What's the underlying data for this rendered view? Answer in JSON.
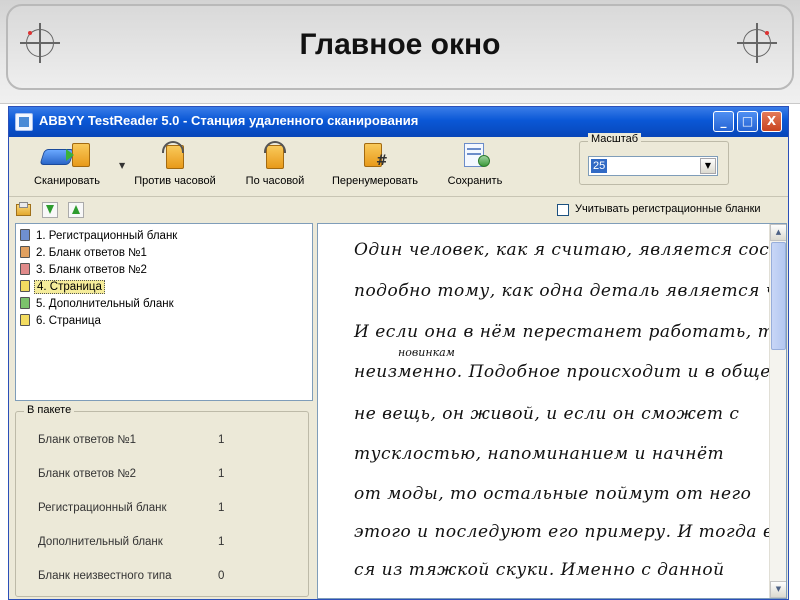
{
  "slide": {
    "title": "Главное окно"
  },
  "window": {
    "title": "ABBYY TestReader 5.0 - Станция удаленного сканирования",
    "controls": {
      "minimize": "_",
      "maximize": "□",
      "close": "X"
    }
  },
  "toolbar": {
    "buttons": [
      {
        "label": "Сканировать",
        "icon": "scanner-icon"
      },
      {
        "label": "Против часовой",
        "icon": "rotate-ccw-icon"
      },
      {
        "label": "По часовой",
        "icon": "rotate-cw-icon"
      },
      {
        "label": "Перенумеровать",
        "icon": "renumber-icon"
      },
      {
        "label": "Сохранить",
        "icon": "save-icon"
      }
    ],
    "scale": {
      "label": "Масштаб",
      "value": "25"
    }
  },
  "toolbar2": {
    "checkbox_label": "Учитывать регистрационные бланки",
    "checkbox_checked": false
  },
  "doc_list": {
    "items": [
      {
        "label": "1. Регистрационный бланк",
        "icon_color": "#6f8fd0"
      },
      {
        "label": "2. Бланк ответов №1",
        "icon_color": "#e0a060"
      },
      {
        "label": "3. Бланк ответов №2",
        "icon_color": "#e08a8a"
      },
      {
        "label": "4. Страница",
        "icon_color": "#f3dc60"
      },
      {
        "label": "5. Дополнительный бланк",
        "icon_color": "#7cc36c"
      },
      {
        "label": "6. Страница",
        "icon_color": "#f3dc60"
      }
    ],
    "selected_index": 3
  },
  "packet": {
    "title": "В пакете",
    "rows": [
      {
        "label": "Бланк ответов №1",
        "count": "1"
      },
      {
        "label": "Бланк ответов №2",
        "count": "1"
      },
      {
        "label": "Регистрационный бланк",
        "count": "1"
      },
      {
        "label": "Дополнительный бланк",
        "count": "1"
      },
      {
        "label": "Бланк неизвестного типа",
        "count": "0"
      }
    ]
  },
  "image_view": {
    "lines": [
      "Один человек, как я считаю, является сос",
      "подобно тому, как одна деталь является ч",
      "И если она в нём перестанет работать, то",
      "неизменно. Подобное происходит и в обществе",
      "не вещь, он живой, и если он сможет с",
      "тусклостью, напоминанием и начнёт",
      "от моды, то остальные поймут от него",
      "этого и последуют его примеру. И тогда в",
      "ся из тяжкой скуки. Именно с данной"
    ],
    "insertion_note": "новинкам"
  }
}
